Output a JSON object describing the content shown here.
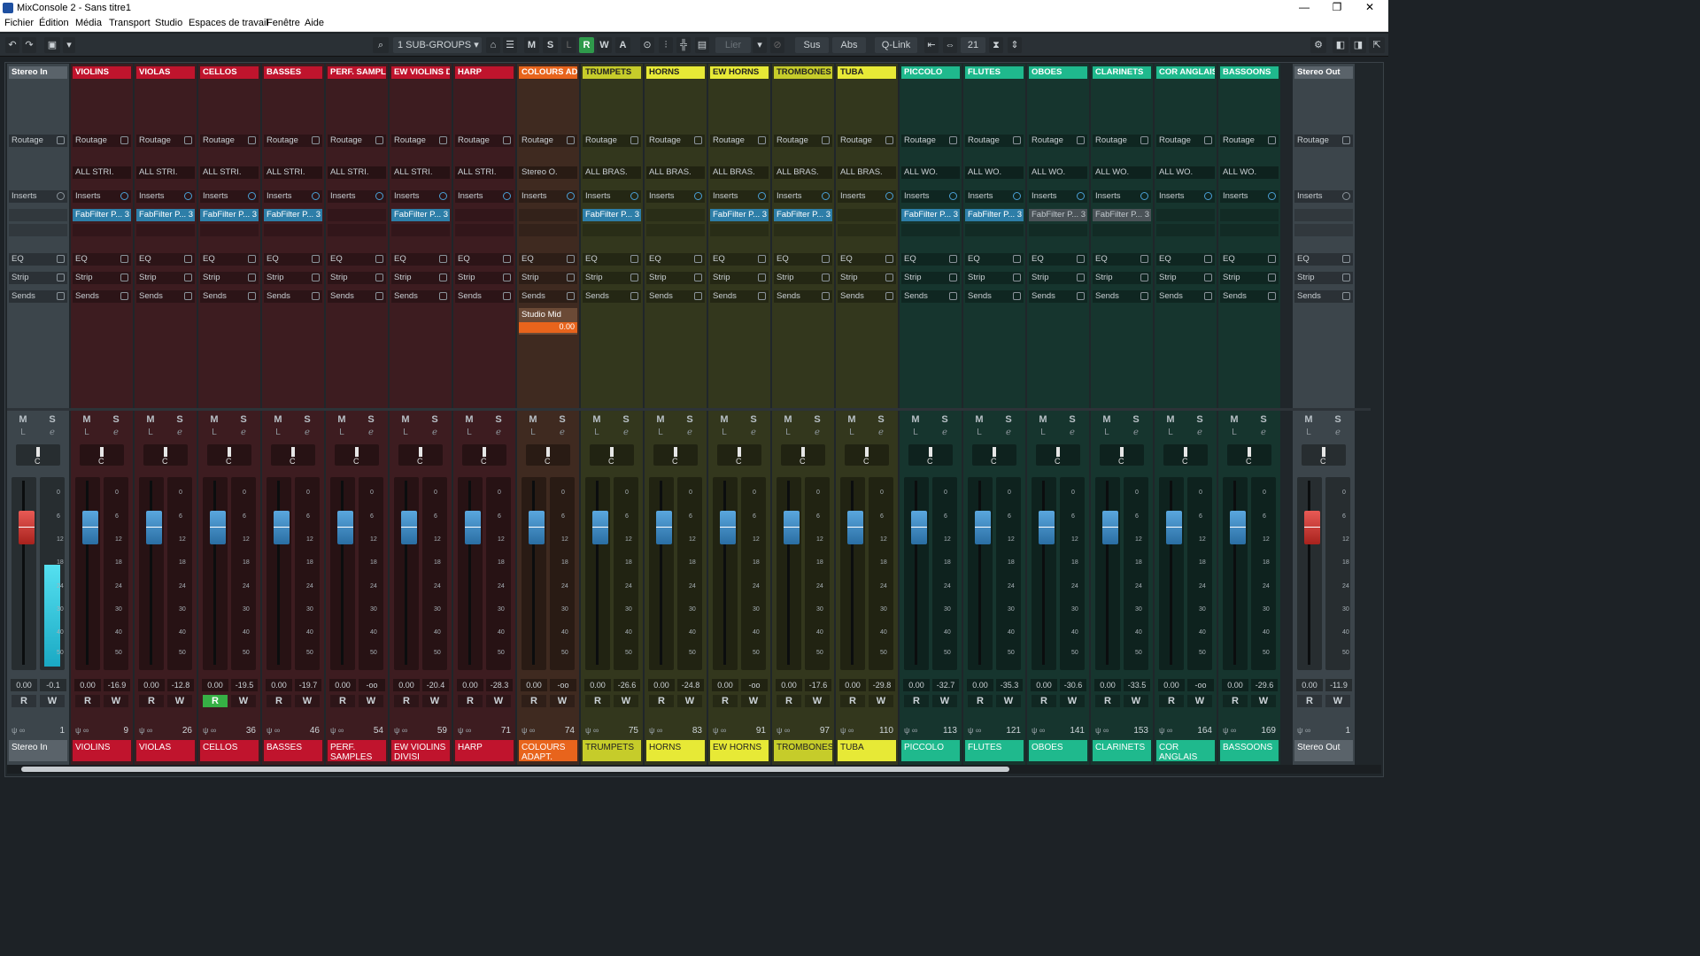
{
  "window": {
    "title": "MixConsole 2 - Sans titre1"
  },
  "menu": [
    "Fichier",
    "Édition",
    "Média",
    "Transport",
    "Studio",
    "Espaces de travail",
    "Fenêtre",
    "Aide"
  ],
  "toolbar": {
    "visibility": "1 SUB-GROUPS",
    "m": "M",
    "s": "S",
    "l": "L",
    "r": "R",
    "w": "W",
    "a": "A",
    "lier": "Lier",
    "sus": "Sus",
    "abs": "Abs",
    "qlink": "Q-Link",
    "count": "21"
  },
  "strip": {
    "routage": "Routage",
    "inserts": "Inserts",
    "eq": "EQ",
    "strip": "Strip",
    "sends": "Sends",
    "m": "M",
    "s": "S",
    "l": "L",
    "r": "R",
    "w": "W",
    "pan_c": "C"
  },
  "scale_marks": [
    "0",
    "6",
    "12",
    "18",
    "24",
    "30",
    "40",
    "50"
  ],
  "send_box": {
    "name": "Studio Mid",
    "value": "0.00"
  },
  "channels": [
    {
      "name": "Stereo In",
      "bottom": "Stereo In",
      "num": "1",
      "routing": "",
      "plugin": "",
      "fader": "0.00",
      "peak": "-0.1",
      "bg": "#3c454b",
      "head": "#5a636a",
      "bot": "#5a636a",
      "cap": "red",
      "meter": 0.55,
      "rwR": false
    },
    {
      "name": "VIOLINS",
      "bottom": "VIOLINS",
      "num": "9",
      "routing": "ALL STRI.",
      "plugin": "FabFilter P... 3",
      "fader": "0.00",
      "peak": "-16.9",
      "bg": "#3d1c20",
      "head": "#c0142d",
      "bot": "#c0142d",
      "cap": "blue",
      "meter": 0,
      "rwR": false
    },
    {
      "name": "VIOLAS",
      "bottom": "VIOLAS",
      "num": "26",
      "routing": "ALL STRI.",
      "plugin": "FabFilter P... 3",
      "fader": "0.00",
      "peak": "-12.8",
      "bg": "#3d1c20",
      "head": "#c0142d",
      "bot": "#c0142d",
      "cap": "blue",
      "meter": 0,
      "rwR": false
    },
    {
      "name": "CELLOS",
      "bottom": "CELLOS",
      "num": "36",
      "routing": "ALL STRI.",
      "plugin": "FabFilter P... 3",
      "fader": "0.00",
      "peak": "-19.5",
      "bg": "#3d1c20",
      "head": "#c0142d",
      "bot": "#c0142d",
      "cap": "blue",
      "meter": 0,
      "rwR": true
    },
    {
      "name": "BASSES",
      "bottom": "BASSES",
      "num": "46",
      "routing": "ALL STRI.",
      "plugin": "FabFilter P... 3",
      "fader": "0.00",
      "peak": "-19.7",
      "bg": "#3d1c20",
      "head": "#c0142d",
      "bot": "#c0142d",
      "cap": "blue",
      "meter": 0,
      "rwR": false
    },
    {
      "name": "PERF. SAMPLES",
      "bottom": "PERF. SAMPLES",
      "num": "54",
      "routing": "ALL STRI.",
      "plugin": "",
      "fader": "0.00",
      "peak": "-oo",
      "bg": "#3d1c20",
      "head": "#c0142d",
      "bot": "#c0142d",
      "cap": "blue",
      "meter": 0,
      "rwR": false
    },
    {
      "name": "EW VIOLINS D.",
      "bottom": "EW VIOLINS DIVISI",
      "num": "59",
      "routing": "ALL STRI.",
      "plugin": "FabFilter P... 3",
      "fader": "0.00",
      "peak": "-20.4",
      "bg": "#3d1c20",
      "head": "#c0142d",
      "bot": "#c0142d",
      "cap": "blue",
      "meter": 0,
      "rwR": false
    },
    {
      "name": "HARP",
      "bottom": "HARP",
      "num": "71",
      "routing": "ALL STRI.",
      "plugin": "",
      "fader": "0.00",
      "peak": "-28.3",
      "bg": "#3d1c20",
      "head": "#c0142d",
      "bot": "#c0142d",
      "cap": "blue",
      "meter": 0,
      "rwR": false
    },
    {
      "name": "COLOURS ADA.",
      "bottom": "COLOURS ADAPT. RUNS",
      "num": "74",
      "routing": "Stereo O.",
      "plugin": "",
      "fader": "0.00",
      "peak": "-oo",
      "bg": "#3f2a20",
      "head": "#e8641c",
      "bot": "#e8641c",
      "cap": "blue",
      "meter": 0,
      "rwR": false
    },
    {
      "name": "TRUMPETS",
      "bottom": "TRUMPETS",
      "num": "75",
      "routing": "ALL BRAS.",
      "plugin": "FabFilter P... 3",
      "fader": "0.00",
      "peak": "-26.6",
      "bg": "#33371d",
      "head": "#c6cc2a",
      "bot": "#c6cc2a",
      "cap": "blue",
      "meter": 0,
      "rwR": false
    },
    {
      "name": "HORNS",
      "bottom": "HORNS",
      "num": "83",
      "routing": "ALL BRAS.",
      "plugin": "",
      "fader": "0.00",
      "peak": "-24.8",
      "bg": "#33371d",
      "head": "#e7e936",
      "bot": "#e7e936",
      "cap": "blue",
      "meter": 0,
      "rwR": false
    },
    {
      "name": "EW HORNS",
      "bottom": "EW HORNS",
      "num": "91",
      "routing": "ALL BRAS.",
      "plugin": "FabFilter P... 3",
      "fader": "0.00",
      "peak": "-oo",
      "bg": "#33371d",
      "head": "#e7e936",
      "bot": "#e7e936",
      "cap": "blue",
      "meter": 0,
      "rwR": false
    },
    {
      "name": "TROMBONES",
      "bottom": "TROMBONES",
      "num": "97",
      "routing": "ALL BRAS.",
      "plugin": "FabFilter P... 3",
      "fader": "0.00",
      "peak": "-17.6",
      "bg": "#33371d",
      "head": "#c6cc2a",
      "bot": "#c6cc2a",
      "cap": "blue",
      "meter": 0,
      "rwR": false
    },
    {
      "name": "TUBA",
      "bottom": "TUBA",
      "num": "110",
      "routing": "ALL BRAS.",
      "plugin": "",
      "fader": "0.00",
      "peak": "-29.8",
      "bg": "#33371d",
      "head": "#e7e936",
      "bot": "#e7e936",
      "cap": "blue",
      "meter": 0,
      "rwR": false
    },
    {
      "name": "PICCOLO",
      "bottom": "PICCOLO",
      "num": "113",
      "routing": "ALL WO.",
      "plugin": "FabFilter P... 3",
      "fader": "0.00",
      "peak": "-32.7",
      "bg": "#16352e",
      "head": "#1fb98d",
      "bot": "#1fb98d",
      "cap": "blue",
      "meter": 0,
      "rwR": false
    },
    {
      "name": "FLUTES",
      "bottom": "FLUTES",
      "num": "121",
      "routing": "ALL WO.",
      "plugin": "FabFilter P... 3",
      "fader": "0.00",
      "peak": "-35.3",
      "bg": "#16352e",
      "head": "#1fb98d",
      "bot": "#1fb98d",
      "cap": "blue",
      "meter": 0,
      "rwR": false
    },
    {
      "name": "OBOES",
      "bottom": "OBOES",
      "num": "141",
      "routing": "ALL WO.",
      "plugin": "FabFilter P... 3",
      "fader": "0.00",
      "peak": "-30.6",
      "bg": "#16352e",
      "head": "#1fb98d",
      "bot": "#1fb98d",
      "cap": "blue",
      "meter": 0,
      "rwR": false,
      "off": true
    },
    {
      "name": "CLARINETS",
      "bottom": "CLARINETS",
      "num": "153",
      "routing": "ALL WO.",
      "plugin": "FabFilter P... 3",
      "fader": "0.00",
      "peak": "-33.5",
      "bg": "#16352e",
      "head": "#1fb98d",
      "bot": "#1fb98d",
      "cap": "blue",
      "meter": 0,
      "rwR": false,
      "off": true
    },
    {
      "name": "COR ANGLAIS",
      "bottom": "COR ANGLAIS",
      "num": "164",
      "routing": "ALL WO.",
      "plugin": "",
      "fader": "0.00",
      "peak": "-oo",
      "bg": "#16352e",
      "head": "#1fb98d",
      "bot": "#1fb98d",
      "cap": "blue",
      "meter": 0,
      "rwR": false
    },
    {
      "name": "BASSOONS",
      "bottom": "BASSOONS",
      "num": "169",
      "routing": "ALL WO.",
      "plugin": "",
      "fader": "0.00",
      "peak": "-29.6",
      "bg": "#16352e",
      "head": "#1fb98d",
      "bot": "#1fb98d",
      "cap": "blue",
      "meter": 0,
      "rwR": false
    },
    {
      "name": "Stereo Out",
      "bottom": "Stereo Out",
      "num": "1",
      "routing": "",
      "plugin": "",
      "fader": "0.00",
      "peak": "-11.9",
      "bg": "#3c454b",
      "head": "#5a636a",
      "bot": "#5a636a",
      "cap": "red",
      "meter": 0,
      "rwR": false
    }
  ]
}
